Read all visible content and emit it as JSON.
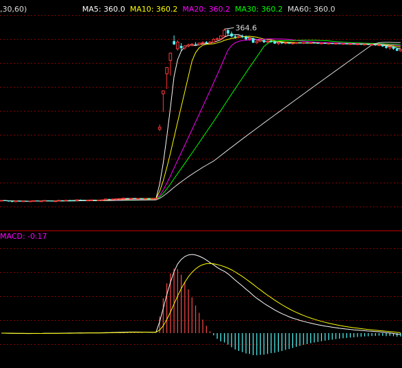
{
  "chart_data": [
    {
      "type": "candlestick",
      "panel": "price",
      "header_prefix": ",30,60)",
      "legend": [
        {
          "name": "MA5",
          "value": "360.0",
          "color": "#ffffff"
        },
        {
          "name": "MA10",
          "value": "360.2",
          "color": "#ffff00"
        },
        {
          "name": "MA20",
          "value": "360.2",
          "color": "#ff00ff"
        },
        {
          "name": "MA30",
          "value": "360.2",
          "color": "#00ff00"
        },
        {
          "name": "MA60",
          "value": "360.0",
          "color": "#dddddd"
        }
      ],
      "annotation": "364.6",
      "colors": {
        "up": "#ff3b3b",
        "down": "#54ffff",
        "grid": "#8a0000",
        "border": "#c00000"
      },
      "candles": [
        [
          185.6,
          185.9,
          184.8,
          185.6
        ],
        [
          185.6,
          186.0,
          185.0,
          185.2
        ],
        [
          185.2,
          185.6,
          184.4,
          184.9
        ],
        [
          184.9,
          185.2,
          183.6,
          184.2
        ],
        [
          184.2,
          185.4,
          184.0,
          185.1
        ],
        [
          185.1,
          185.3,
          184.3,
          184.6
        ],
        [
          184.6,
          185.3,
          184.4,
          185.0
        ],
        [
          185.0,
          185.1,
          184.2,
          184.5
        ],
        [
          184.5,
          185.2,
          184.1,
          184.9
        ],
        [
          184.9,
          185.5,
          184.6,
          185.3
        ],
        [
          185.3,
          185.4,
          184.6,
          184.8
        ],
        [
          184.8,
          185.3,
          184.6,
          185.0
        ],
        [
          185.0,
          185.8,
          184.8,
          185.6
        ],
        [
          185.6,
          185.7,
          184.9,
          185.2
        ],
        [
          185.2,
          185.4,
          184.4,
          184.7
        ],
        [
          184.7,
          185.2,
          184.5,
          185.0
        ],
        [
          185.0,
          185.9,
          184.9,
          185.7
        ],
        [
          185.7,
          185.9,
          185.0,
          185.3
        ],
        [
          185.3,
          186.0,
          185.1,
          185.8
        ],
        [
          185.8,
          186.2,
          185.2,
          185.5
        ],
        [
          185.5,
          185.9,
          185.0,
          185.4
        ],
        [
          185.4,
          186.5,
          185.3,
          186.3
        ],
        [
          186.3,
          186.5,
          185.5,
          185.9
        ],
        [
          185.9,
          186.2,
          185.4,
          185.6
        ],
        [
          185.6,
          186.0,
          185.2,
          185.8
        ],
        [
          185.8,
          186.3,
          185.6,
          186.1
        ],
        [
          186.1,
          186.2,
          185.4,
          185.7
        ],
        [
          185.7,
          186.1,
          185.3,
          185.9
        ],
        [
          185.9,
          186.4,
          185.7,
          186.2
        ],
        [
          186.2,
          187.4,
          186.0,
          187.1
        ],
        [
          187.1,
          187.3,
          186.4,
          186.7
        ],
        [
          186.7,
          187.4,
          186.5,
          187.1
        ],
        [
          187.1,
          187.5,
          186.8,
          187.3
        ],
        [
          187.3,
          187.6,
          186.9,
          187.5
        ],
        [
          187.5,
          188.4,
          187.3,
          187.9
        ],
        [
          187.9,
          188.2,
          187.2,
          187.6
        ],
        [
          187.6,
          188.0,
          187.1,
          187.8
        ],
        [
          187.8,
          188.1,
          187.3,
          187.5
        ],
        [
          187.5,
          187.9,
          187.0,
          187.7
        ],
        [
          187.7,
          188.0,
          187.2,
          187.4
        ],
        [
          187.4,
          187.8,
          187.0,
          187.6
        ],
        [
          187.6,
          187.9,
          187.1,
          187.3
        ],
        [
          187.3,
          187.7,
          186.9,
          187.5
        ],
        [
          187.5,
          187.9,
          187.2,
          187.7
        ],
        [
          260.0,
          265.0,
          258.0,
          262.0
        ],
        [
          297.0,
          300.5,
          278.0,
          300.0
        ],
        [
          318.0,
          325.0,
          302.0,
          324.5
        ],
        [
          332.0,
          340.0,
          316.0,
          339.5
        ],
        [
          352.0,
          358.0,
          348.0,
          348.7
        ],
        [
          344.0,
          353.0,
          342.0,
          351.0
        ],
        [
          347.0,
          350.0,
          342.0,
          344.8
        ],
        [
          345.0,
          348.0,
          343.0,
          347.0
        ],
        [
          347.0,
          349.5,
          345.5,
          348.0
        ],
        [
          348.0,
          350.0,
          346.5,
          348.8
        ],
        [
          349.0,
          351.0,
          347.0,
          348.5
        ],
        [
          348.5,
          350.5,
          347.0,
          350.0
        ],
        [
          350.0,
          352.0,
          348.5,
          350.5
        ],
        [
          351.0,
          352.0,
          349.0,
          350.0
        ],
        [
          350.0,
          352.0,
          349.0,
          351.0
        ],
        [
          351.0,
          355.0,
          350.0,
          354.0
        ],
        [
          354.0,
          356.0,
          352.0,
          354.5
        ],
        [
          354.5,
          358.0,
          353.0,
          357.5
        ],
        [
          357.5,
          364.6,
          356.0,
          363.5
        ],
        [
          363.5,
          364.6,
          358.0,
          360.0
        ],
        [
          360.0,
          362.0,
          356.0,
          357.0
        ],
        [
          357.0,
          359.0,
          354.5,
          356.0
        ],
        [
          356.0,
          358.0,
          355.0,
          357.0
        ],
        [
          357.0,
          359.0,
          355.0,
          356.5
        ],
        [
          356.5,
          358.0,
          353.0,
          354.0
        ],
        [
          354.0,
          356.0,
          352.5,
          355.0
        ],
        [
          355.0,
          356.0,
          350.0,
          350.5
        ],
        [
          350.5,
          353.0,
          349.0,
          352.0
        ],
        [
          352.0,
          354.0,
          351.0,
          353.0
        ],
        [
          353.0,
          354.0,
          350.0,
          351.0
        ],
        [
          351.0,
          353.0,
          349.5,
          352.0
        ],
        [
          352.0,
          353.5,
          350.5,
          351.5
        ],
        [
          351.5,
          352.5,
          349.0,
          349.5
        ],
        [
          349.5,
          351.0,
          348.0,
          350.5
        ],
        [
          350.5,
          351.5,
          349.0,
          349.8
        ],
        [
          349.8,
          351.0,
          348.5,
          350.5
        ],
        [
          350.5,
          351.0,
          349.0,
          349.5
        ],
        [
          349.5,
          350.5,
          348.5,
          350.0
        ],
        [
          350.0,
          351.0,
          349.0,
          350.5
        ],
        [
          350.5,
          351.0,
          349.5,
          350.0
        ],
        [
          350.0,
          351.0,
          349.0,
          350.5
        ],
        [
          350.5,
          351.0,
          349.5,
          350.0
        ],
        [
          350.0,
          350.8,
          349.2,
          350.3
        ],
        [
          350.3,
          351.0,
          349.5,
          350.0
        ],
        [
          350.0,
          350.8,
          349.2,
          349.5
        ],
        [
          349.5,
          350.5,
          348.8,
          350.0
        ],
        [
          350.0,
          350.6,
          349.0,
          349.4
        ],
        [
          349.4,
          350.2,
          348.6,
          349.8
        ],
        [
          349.8,
          350.4,
          349.0,
          349.2
        ],
        [
          349.2,
          350.0,
          348.4,
          349.6
        ],
        [
          349.6,
          350.2,
          348.8,
          349.0
        ],
        [
          349.0,
          349.8,
          348.2,
          349.4
        ],
        [
          349.4,
          350.0,
          348.6,
          348.9
        ],
        [
          348.9,
          349.6,
          348.0,
          349.2
        ],
        [
          349.2,
          349.8,
          348.4,
          348.7
        ],
        [
          348.7,
          349.4,
          347.9,
          349.0
        ],
        [
          349.0,
          349.5,
          348.0,
          348.4
        ],
        [
          348.4,
          349.2,
          347.6,
          348.8
        ],
        [
          348.8,
          349.3,
          347.8,
          348.1
        ],
        [
          348.1,
          348.9,
          347.4,
          348.5
        ],
        [
          348.5,
          349.0,
          347.2,
          347.7
        ],
        [
          347.7,
          348.5,
          346.6,
          348.1
        ],
        [
          348.1,
          348.6,
          346.0,
          346.6
        ],
        [
          346.6,
          347.5,
          344.0,
          345.0
        ],
        [
          345.0,
          346.0,
          343.0,
          346.2
        ],
        [
          346.2,
          347.0,
          343.0,
          344.0
        ],
        [
          344.0,
          345.0,
          341.6,
          342.0
        ],
        [
          342.0,
          344.0,
          341.0,
          343.5
        ]
      ]
    },
    {
      "type": "bar+line",
      "panel": "indicator",
      "name": "MACD",
      "value": "-0.17",
      "label_color": "#ff00ff",
      "colors": {
        "hist_pos": "#ff4a4a",
        "hist_neg": "#54ffff",
        "dif": "#ffffff",
        "dea": "#ffff00"
      },
      "series": [
        "DIF",
        "DEA",
        "MACD"
      ]
    }
  ]
}
